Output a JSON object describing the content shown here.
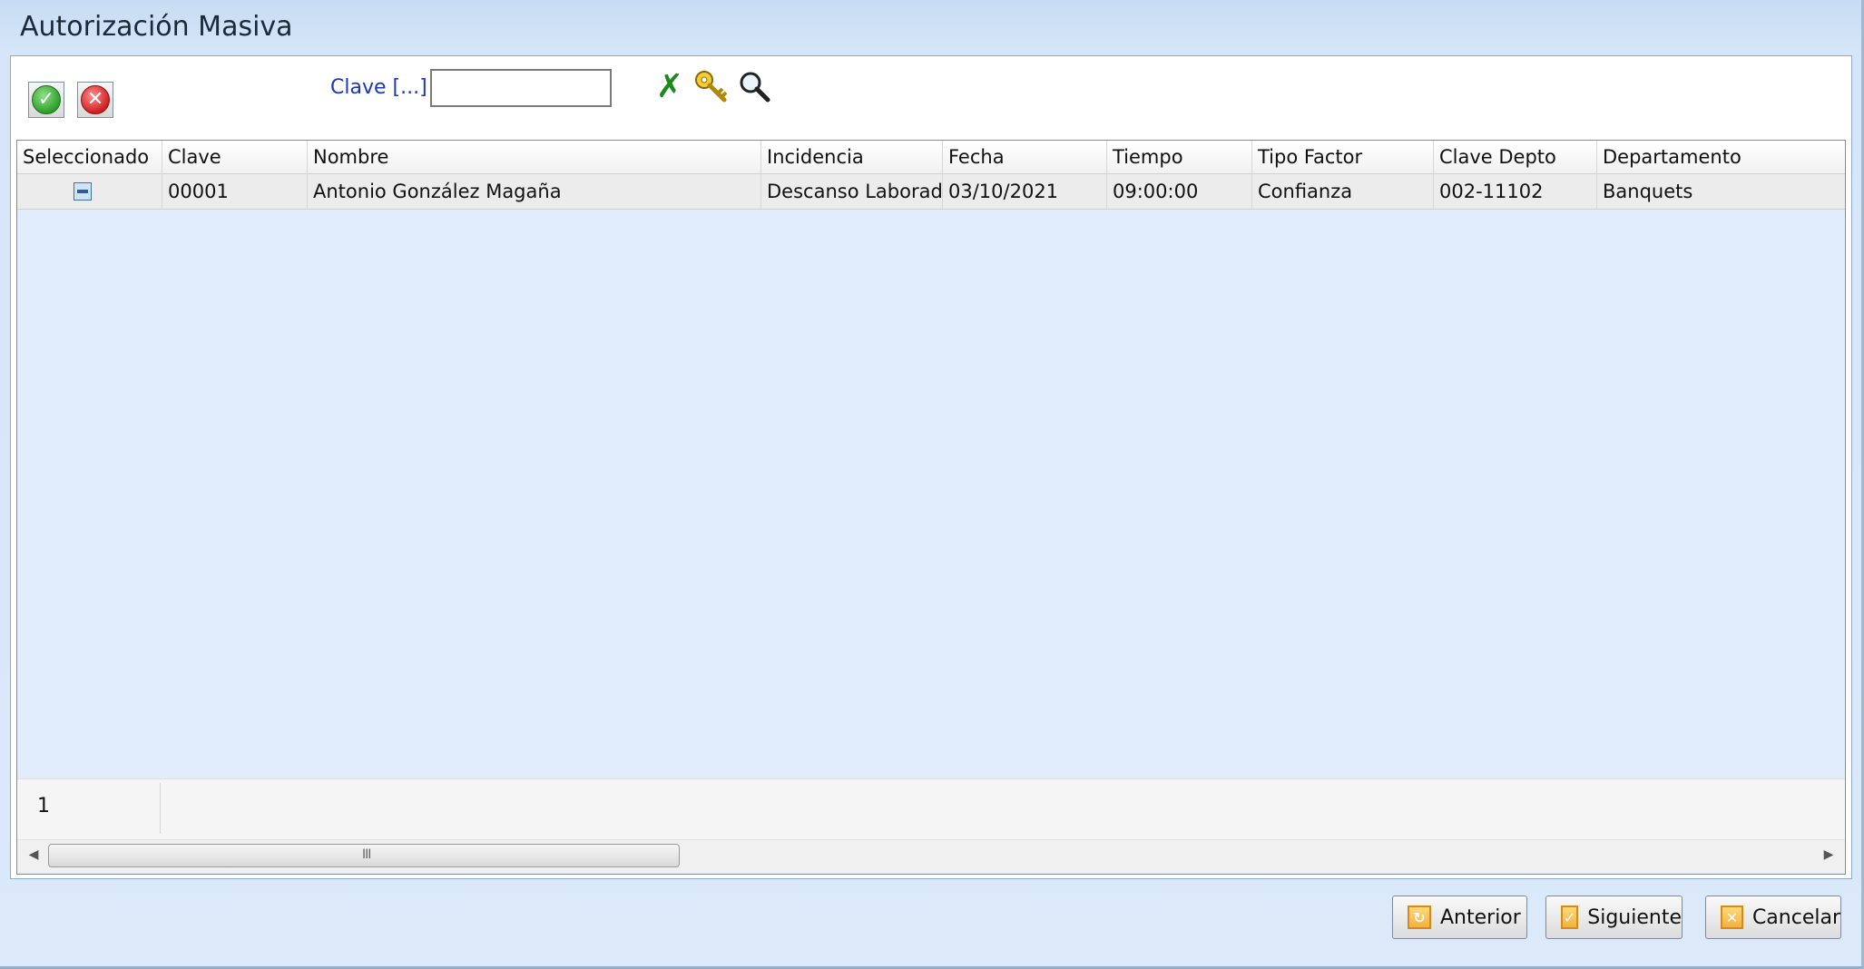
{
  "window": {
    "title": "Autorización Masiva"
  },
  "toolbar": {
    "accept_icon": "check-circle-icon",
    "reject_icon": "x-circle-icon",
    "clave_label": "Clave [...]",
    "clave_value": "",
    "clear_icon": "green-x-icon",
    "key_icon": "key-icon",
    "search_icon": "magnifier-icon"
  },
  "grid": {
    "columns": [
      "Seleccionado",
      "Clave",
      "Nombre",
      "Incidencia",
      "Fecha",
      "Tiempo",
      "Tipo Factor",
      "Clave Depto",
      "Departamento"
    ],
    "rows": [
      {
        "seleccionado": "indeterminate",
        "clave": "00001",
        "nombre": "Antonio González Magaña",
        "incidencia": "Descanso Laborado",
        "fecha": "03/10/2021",
        "tiempo": "09:00:00",
        "tipo_factor": "Confianza",
        "clave_depto": "002-11102",
        "departamento": "Banquets"
      }
    ],
    "footer_count": "1",
    "scrollbar_grip": "III"
  },
  "buttons": {
    "anterior": "Anterior",
    "siguiente": "Siguiente",
    "cancelar": "Cancelar"
  },
  "colors": {
    "window_bg": "#d6e6f7",
    "grid_bg": "#e1edfc",
    "link": "#1c37b8",
    "button_icon": "#f3b23e"
  }
}
